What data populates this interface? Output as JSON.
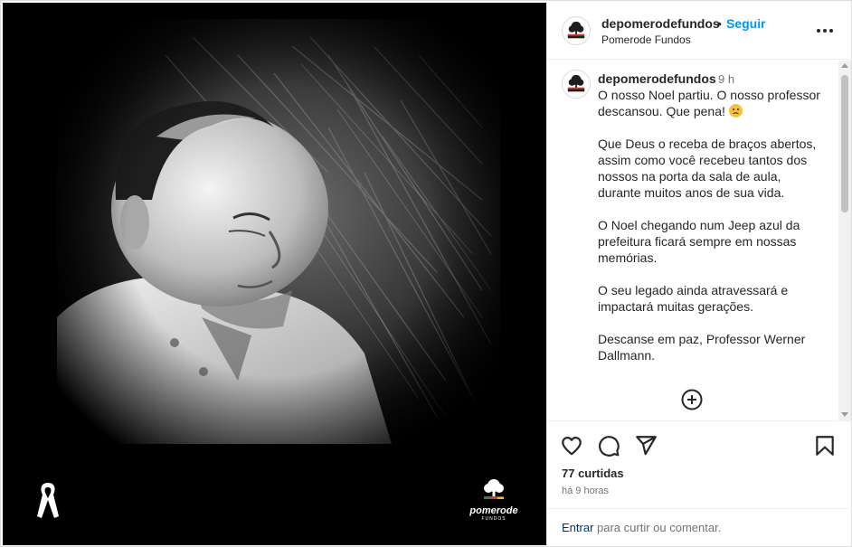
{
  "post": {
    "watermark_text": "pomerode",
    "watermark_sub": "FUNDOS"
  },
  "header": {
    "username": "depomerodefundos",
    "separator": "•",
    "follow_label": "Seguir",
    "location": "Pomerode Fundos"
  },
  "caption": {
    "username": "depomerodefundos",
    "time": "9 h",
    "paragraphs": [
      "O nosso Noel partiu. O nosso professor descansou. Que pena!",
      "Que Deus o receba de braços abertos, assim como você recebeu tantos dos nossos na porta da sala de aula, durante muitos anos de sua vida.",
      "O Noel chegando num Jeep azul da prefeitura ficará sempre em nossas memórias.",
      "O seu legado ainda atravessará e impactará muitas gerações.",
      "Descanse em paz, Professor Werner Dallmann."
    ]
  },
  "stats": {
    "likes": "77 curtidas",
    "ago": "há 9 horas"
  },
  "footer": {
    "login_link": "Entrar",
    "login_rest": " para curtir ou comentar."
  },
  "colors": {
    "follow": "#0095f6",
    "link": "#00376b",
    "muted": "#737373"
  },
  "icons": [
    "heart-icon",
    "comment-icon",
    "share-icon",
    "bookmark-icon",
    "more-icon",
    "plus-circle-icon",
    "mourning-ribbon-icon",
    "pomerode-logo"
  ]
}
